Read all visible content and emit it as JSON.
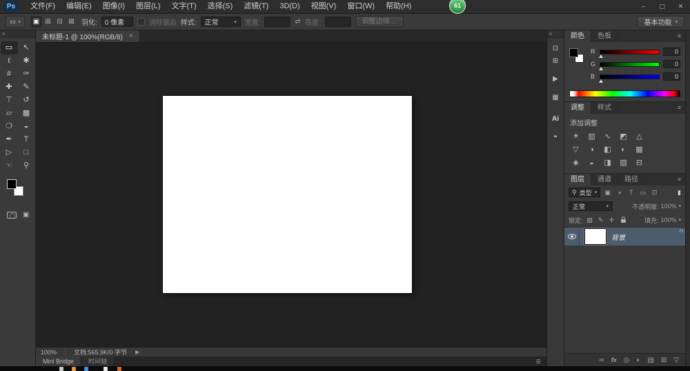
{
  "ui": {
    "caret_down": "▾",
    "collapse_left": "«",
    "panel_menu": "≡",
    "list_menu": "≣",
    "search_glyph": "⚲"
  },
  "colors": {
    "foreground": "#000000",
    "background": "#ffffff",
    "badge_green": "#39ad52",
    "selected_layer": "#4d5c6c"
  },
  "app": {
    "logo": "Ps"
  },
  "menubar": {
    "items": [
      "文件(F)",
      "编辑(E)",
      "图像(I)",
      "图层(L)",
      "文字(T)",
      "选择(S)",
      "滤镜(T)",
      "3D(D)",
      "视图(V)",
      "窗口(W)",
      "帮助(H)"
    ],
    "window_controls": {
      "minimize": "–",
      "maximize": "▢",
      "close": "✕"
    }
  },
  "badge": {
    "value": "61"
  },
  "options_bar": {
    "tool_preset_glyph": "▭",
    "selection_modes": [
      {
        "name": "new-selection",
        "glyph": "▣"
      },
      {
        "name": "add-to-selection",
        "glyph": "⊞"
      },
      {
        "name": "subtract-from-selection",
        "glyph": "⊟"
      },
      {
        "name": "intersect-with-selection",
        "glyph": "⊠"
      }
    ],
    "feather_label": "羽化:",
    "feather_value": "0 像素",
    "antialias_label": "消除锯齿",
    "style_label": "样式:",
    "style_value": "正常",
    "width_label": "宽度:",
    "width_value": "",
    "swap_glyph": "⇄",
    "height_label": "高度:",
    "height_value": "",
    "refine_edge_label": "调整边缘…",
    "workspace_label": "基本功能"
  },
  "document_tab": {
    "title": "未标题-1 @ 100%(RGB/8)",
    "close_glyph": "×"
  },
  "tools": [
    {
      "name": "rectangular-marquee-tool",
      "glyph": "▭",
      "selected": true
    },
    {
      "name": "move-tool",
      "glyph": "↖"
    },
    {
      "name": "lasso-tool",
      "glyph": "ℓ"
    },
    {
      "name": "quick-selection-tool",
      "glyph": "✱"
    },
    {
      "name": "crop-tool",
      "glyph": "#"
    },
    {
      "name": "eyedropper-tool",
      "glyph": "✑"
    },
    {
      "name": "spot-healing-brush-tool",
      "glyph": "✚"
    },
    {
      "name": "brush-tool",
      "glyph": "✎"
    },
    {
      "name": "clone-stamp-tool",
      "glyph": "⊤"
    },
    {
      "name": "history-brush-tool",
      "glyph": "↺"
    },
    {
      "name": "eraser-tool",
      "glyph": "▱"
    },
    {
      "name": "gradient-tool",
      "glyph": "▩"
    },
    {
      "name": "blur-tool",
      "glyph": "❍"
    },
    {
      "name": "dodge-tool",
      "glyph": "◒"
    },
    {
      "name": "pen-tool",
      "glyph": "✒"
    },
    {
      "name": "type-tool",
      "glyph": "T"
    },
    {
      "name": "path-selection-tool",
      "glyph": "▷"
    },
    {
      "name": "rectangle-tool",
      "glyph": "□"
    },
    {
      "name": "hand-tool",
      "glyph": "☜"
    },
    {
      "name": "zoom-tool",
      "glyph": "⚲"
    }
  ],
  "toolbar_extra": {
    "screen_mode_glyph": "▣"
  },
  "rail": {
    "items": [
      {
        "name": "history-panel",
        "glyph": "⊡"
      },
      {
        "name": "properties-panel",
        "glyph": "⊞"
      },
      {
        "name": "actions-panel",
        "glyph": "▶"
      },
      {
        "name": "histogram-panel",
        "glyph": "▦"
      },
      {
        "name": "ai-panel",
        "glyph": "Ai"
      },
      {
        "name": "notes-panel",
        "glyph": "❝"
      }
    ]
  },
  "color_panel": {
    "tabs": [
      "颜色",
      "色板"
    ],
    "channels": [
      {
        "label": "R",
        "value": "0"
      },
      {
        "label": "G",
        "value": "0"
      },
      {
        "label": "B",
        "value": "0"
      }
    ]
  },
  "adjustments_panel": {
    "tabs": [
      "调整",
      "样式"
    ],
    "hint": "添加调整",
    "icons": [
      {
        "name": "brightness-contrast",
        "glyph": "☀"
      },
      {
        "name": "levels",
        "glyph": "▥"
      },
      {
        "name": "curves",
        "glyph": "∿"
      },
      {
        "name": "exposure",
        "glyph": "◩"
      },
      {
        "name": "vibrance",
        "glyph": "△"
      },
      {
        "name": "hue-saturation",
        "glyph": "▽"
      },
      {
        "name": "color-balance",
        "glyph": "◑"
      },
      {
        "name": "black-white",
        "glyph": "◧"
      },
      {
        "name": "photo-filter",
        "glyph": "◐"
      },
      {
        "name": "channel-mixer",
        "glyph": "▦"
      },
      {
        "name": "color-lookup",
        "glyph": "◈"
      },
      {
        "name": "invert",
        "glyph": "◒"
      },
      {
        "name": "posterize",
        "glyph": "◨"
      },
      {
        "name": "threshold",
        "glyph": "▨"
      },
      {
        "name": "gradient-map",
        "glyph": "⊟"
      }
    ]
  },
  "layers_panel": {
    "tabs": [
      "图层",
      "通道",
      "路径"
    ],
    "filter": {
      "label": "类型",
      "icons": [
        {
          "name": "filter-pixel-layers",
          "glyph": "▣"
        },
        {
          "name": "filter-adjustment-layers",
          "glyph": "◑"
        },
        {
          "name": "filter-type-layers",
          "glyph": "T"
        },
        {
          "name": "filter-shape-layers",
          "glyph": "▭"
        },
        {
          "name": "filter-smart-objects",
          "glyph": "⊡"
        }
      ],
      "toggle_glyph": "▮"
    },
    "blend_mode": "正常",
    "opacity_label": "不透明度:",
    "opacity_value": "100%",
    "lock_label": "锁定:",
    "lock_icons": [
      {
        "name": "lock-transparent-pixels",
        "glyph": "▨"
      },
      {
        "name": "lock-image-pixels",
        "glyph": "✎"
      },
      {
        "name": "lock-position",
        "glyph": "✛"
      }
    ],
    "fill_label": "填充:",
    "fill_value": "100%",
    "layers": [
      {
        "name": "背景",
        "locked": true,
        "visible": true
      }
    ],
    "footer": [
      {
        "name": "link-layers",
        "glyph": "∞"
      },
      {
        "name": "layer-style",
        "glyph": "fx"
      },
      {
        "name": "add-layer-mask",
        "glyph": "◎"
      },
      {
        "name": "new-adjustment-layer",
        "glyph": "◐"
      },
      {
        "name": "new-group",
        "glyph": "▤"
      },
      {
        "name": "new-layer",
        "glyph": "⊞"
      },
      {
        "name": "delete-layer",
        "glyph": "▽"
      }
    ]
  },
  "status_bar": {
    "zoom": "100%",
    "doc_info": "文档:565.9K/0 字节",
    "expand_glyph": "▶"
  },
  "bottom_bar": {
    "tabs": [
      "Mini Bridge",
      "时间轴"
    ]
  },
  "taskbar": {
    "icon_colors": [
      "#c9c9c9",
      "#e2993a",
      "#4a90d9",
      "#e8e8e8",
      "#cf6a2e"
    ]
  }
}
